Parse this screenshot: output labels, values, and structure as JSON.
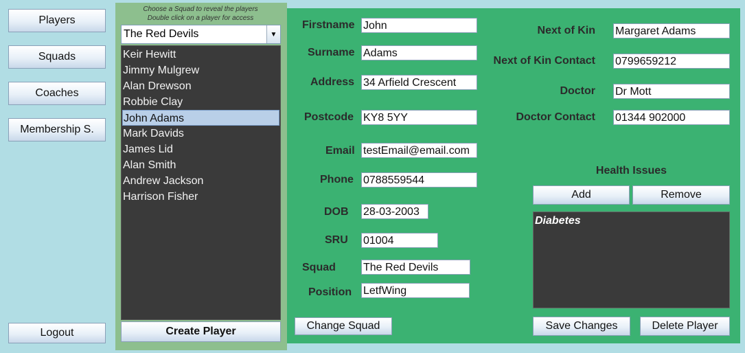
{
  "nav": {
    "players": "Players",
    "squads": "Squads",
    "coaches": "Coaches",
    "membership": "Membership S.",
    "logout": "Logout"
  },
  "squad_panel": {
    "hint_line1": "Choose a Squad to reveal the players",
    "hint_line2": "Double click on a player for access",
    "selected_squad": "The Red Devils",
    "players": [
      "Keir Hewitt",
      "Jimmy Mulgrew",
      "Alan Drewson",
      "Robbie Clay",
      "John Adams",
      "Mark Davids",
      "James Lid",
      "Alan Smith",
      "Andrew Jackson",
      "Harrison Fisher"
    ],
    "selected_player": "John Adams",
    "create_player": "Create Player"
  },
  "form": {
    "firstname_label": "Firstname",
    "firstname": "John",
    "surname_label": "Surname",
    "surname": "Adams",
    "address_label": "Address",
    "address": "34 Arfield Crescent",
    "postcode_label": "Postcode",
    "postcode": "KY8 5YY",
    "email_label": "Email",
    "email": "testEmail@email.com",
    "phone_label": "Phone",
    "phone": "0788559544",
    "dob_label": "DOB",
    "dob": "28-03-2003",
    "sru_label": "SRU",
    "sru": "01004",
    "squad_label": "Squad",
    "squad": "The Red Devils",
    "position_label": "Position",
    "position": "LetfWing",
    "kin_label": "Next of Kin",
    "kin": "Margaret Adams",
    "kin_contact_label": "Next of Kin Contact",
    "kin_contact": "0799659212",
    "doctor_label": "Doctor",
    "doctor": "Dr Mott",
    "doctor_contact_label": "Doctor Contact",
    "doctor_contact": "01344 902000",
    "health_label": "Health Issues",
    "add": "Add",
    "remove": "Remove",
    "health_items": [
      "Diabetes"
    ],
    "change_squad": "Change Squad",
    "save_changes": "Save Changes",
    "delete_player": "Delete Player"
  },
  "colors": {
    "nav_bg": "#b1dde4",
    "squad_panel_bg": "#8dbf8e",
    "form_bg": "#3bb272",
    "list_bg": "#3a3a3a",
    "selection": "#b9cfe8"
  }
}
